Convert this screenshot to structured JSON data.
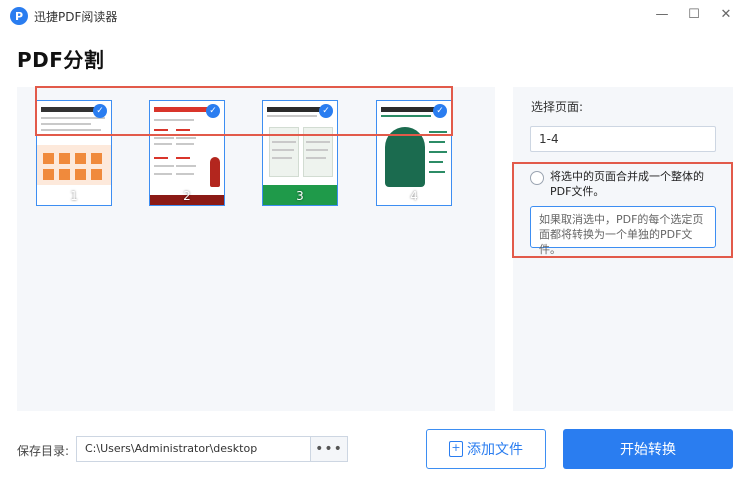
{
  "app": {
    "title": "迅捷PDF阅读器",
    "logo_glyph": "P"
  },
  "window_controls": {
    "minimize": "—",
    "maximize": "☐",
    "close": "✕"
  },
  "page_title": "PDF分割",
  "thumbnails": [
    {
      "number": "1",
      "selected": true
    },
    {
      "number": "2",
      "selected": true
    },
    {
      "number": "3",
      "selected": true
    },
    {
      "number": "4",
      "selected": true
    }
  ],
  "side": {
    "pages_label": "选择页面:",
    "pages_value": "1-4",
    "merge_option_label": "将选中的页面合并成一个整体的PDF文件。",
    "merge_checked": false,
    "hint": "如果取消选中，PDF的每个选定页面都将转换为一个单独的PDF文件。"
  },
  "footer": {
    "save_label": "保存目录:",
    "save_path": "C:\\Users\\Administrator\\desktop",
    "browse_label": "•••",
    "add_file_label": "添加文件",
    "start_label": "开始转换"
  },
  "colors": {
    "accent": "#2a7df0",
    "highlight": "#e25a4a",
    "panel_bg": "#f5f7fa"
  }
}
